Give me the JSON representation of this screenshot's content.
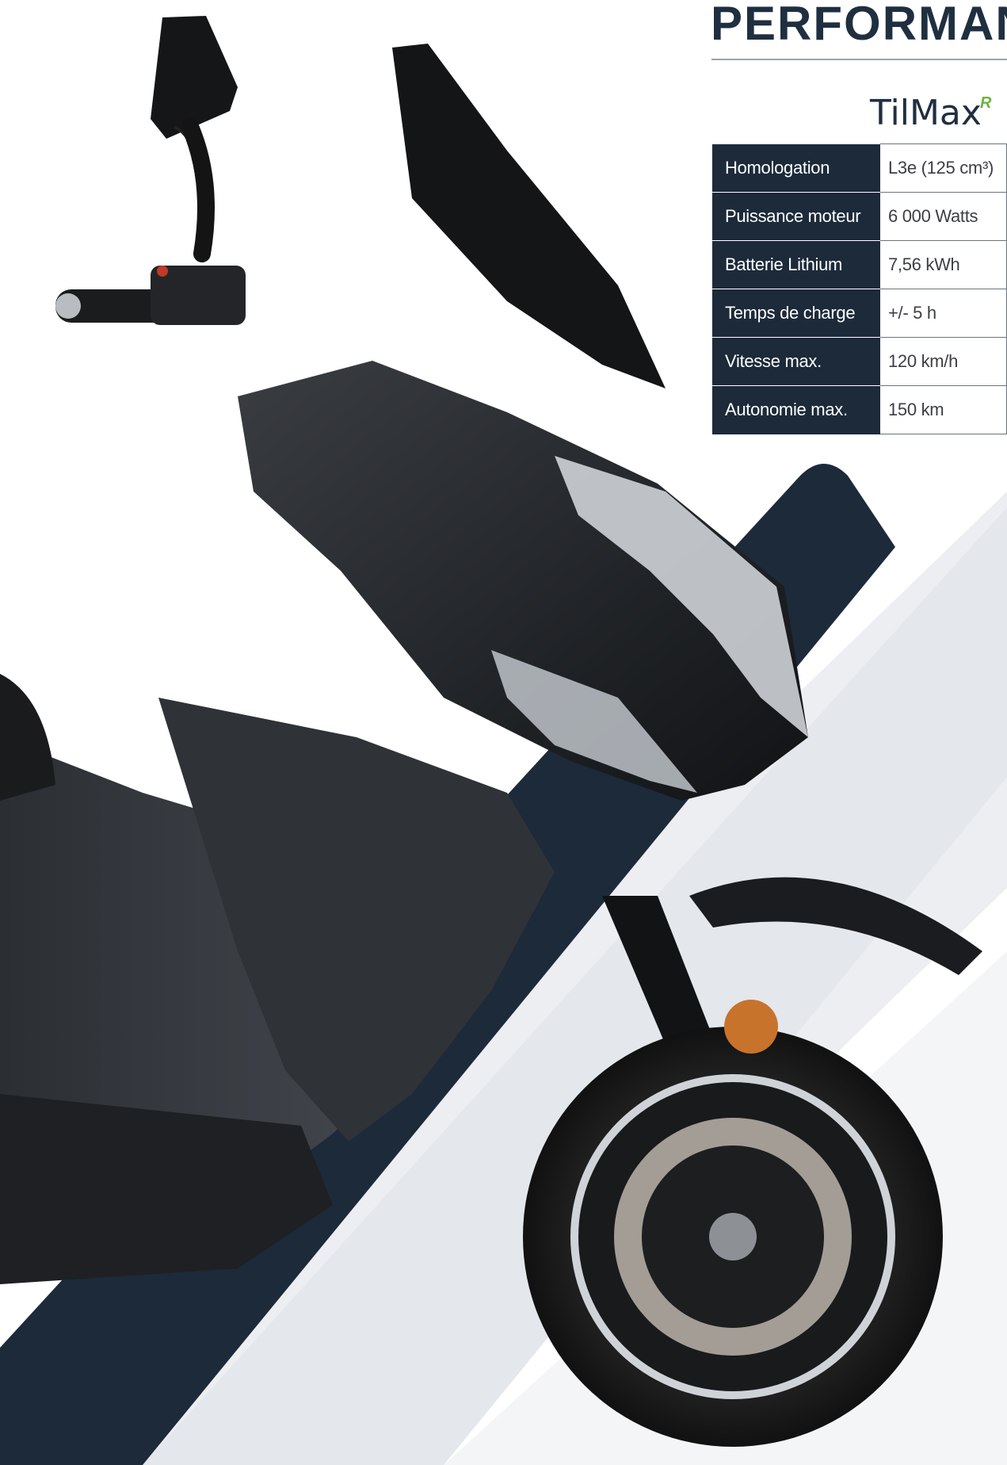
{
  "header": {
    "section_title": "PERFORMANC",
    "model_name": "TilMax",
    "model_mark": "R"
  },
  "colors": {
    "navy": "#1c2a3a",
    "accent_green": "#6db33f",
    "light_grey": "#e9ebee"
  },
  "specs": [
    {
      "label": "Homologation",
      "value": "L3e (125 cm³)"
    },
    {
      "label": "Puissance moteur",
      "value": "6 000 Watts"
    },
    {
      "label": "Batterie Lithium",
      "value": "7,56 kWh"
    },
    {
      "label": "Temps de charge",
      "value": "+/- 5 h"
    },
    {
      "label": "Vitesse max.",
      "value": "120 km/h"
    },
    {
      "label": "Autonomie max.",
      "value": "150 km"
    }
  ],
  "image": {
    "subject": "scooter-photo"
  }
}
